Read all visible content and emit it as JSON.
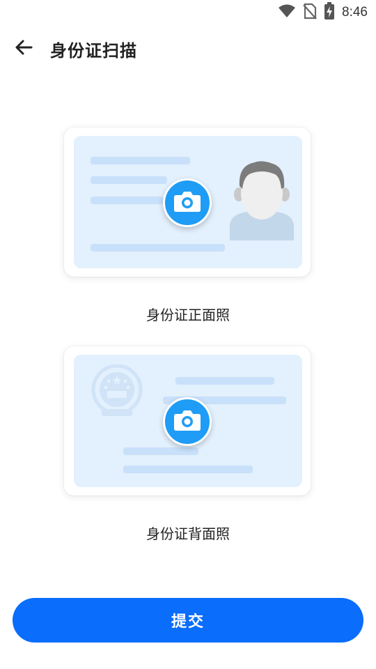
{
  "status_bar": {
    "time": "8:46",
    "icons": [
      "wifi-icon",
      "no-sim-icon",
      "battery-charging-icon"
    ]
  },
  "header": {
    "back_icon": "arrow-left-icon",
    "title": "身份证扫描"
  },
  "cards": [
    {
      "label": "身份证正面照",
      "icon": "camera-icon"
    },
    {
      "label": "身份证背面照",
      "icon": "camera-icon"
    }
  ],
  "submit_label": "提交",
  "colors": {
    "primary": "#0a6dfb",
    "camera": "#1f9cf5",
    "card_fill": "#e3f0fd",
    "card_lines": "#c8e0fa"
  }
}
